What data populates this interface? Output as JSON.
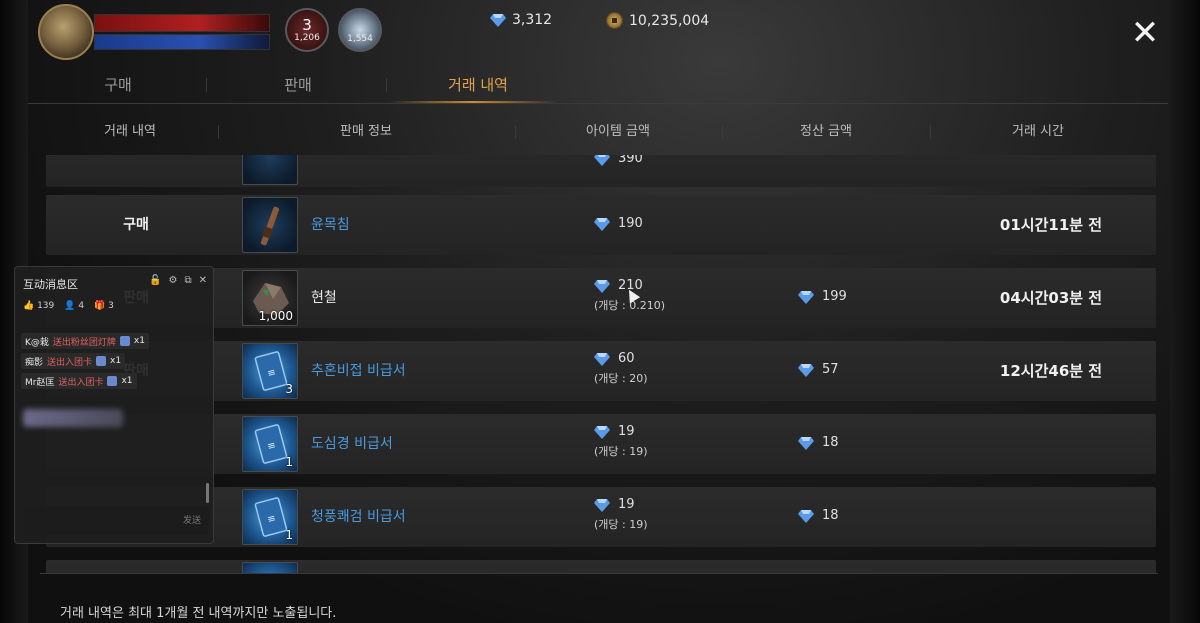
{
  "player": {
    "potion_count": "3",
    "potion_sub": "1,206",
    "bowl_sub": "1,554"
  },
  "currency": {
    "diamond": "3,312",
    "gold": "10,235,004",
    "diamond_color": "#5a9ae8"
  },
  "close_label": "✕",
  "tabs": [
    {
      "label": "구매"
    },
    {
      "label": "판매"
    },
    {
      "label": "거래 내역",
      "active": true
    }
  ],
  "columns": [
    "거래 내역",
    "판매 정보",
    "아이템 금액",
    "정산 금액",
    "거래 시간"
  ],
  "rows": [
    {
      "type": "",
      "name": "",
      "qty": "",
      "price": "390",
      "unit": "",
      "settle": "",
      "time": ""
    },
    {
      "type": "구매",
      "name": "윤목침",
      "qty": "",
      "price": "190",
      "unit": "",
      "settle": "",
      "time": "01시간11분 전"
    },
    {
      "type": "판매",
      "name": "현철",
      "qty": "1,000",
      "price": "210",
      "unit": "(개당 : 0.210)",
      "settle": "199",
      "time": "04시간03분 전"
    },
    {
      "type": "판매",
      "name": "추혼비접 비급서",
      "qty": "3",
      "price": "60",
      "unit": "(개당 : 20)",
      "settle": "57",
      "time": "12시간46분 전"
    },
    {
      "type": "",
      "name": "도심경 비급서",
      "qty": "1",
      "price": "19",
      "unit": "(개당 : 19)",
      "settle": "18",
      "time": ""
    },
    {
      "type": "",
      "name": "청풍쾌검 비급서",
      "qty": "1",
      "price": "19",
      "unit": "(개당 : 19)",
      "settle": "18",
      "time": ""
    }
  ],
  "overlay": {
    "title": "互动消息区",
    "stats": [
      "139",
      "4",
      "3"
    ],
    "lines": [
      {
        "user": "K@栽",
        "action": "送出粉丝团灯牌",
        "count": "x1"
      },
      {
        "user": "痴影",
        "action": "送出入团卡",
        "count": "x1"
      },
      {
        "user": "Mr赵匡",
        "action": "送出入团卡",
        "count": "x1"
      }
    ],
    "send_label": "发送"
  },
  "footer_note": "거래 내역은 최대 1개월 전 내역까지만 노출됩니다."
}
